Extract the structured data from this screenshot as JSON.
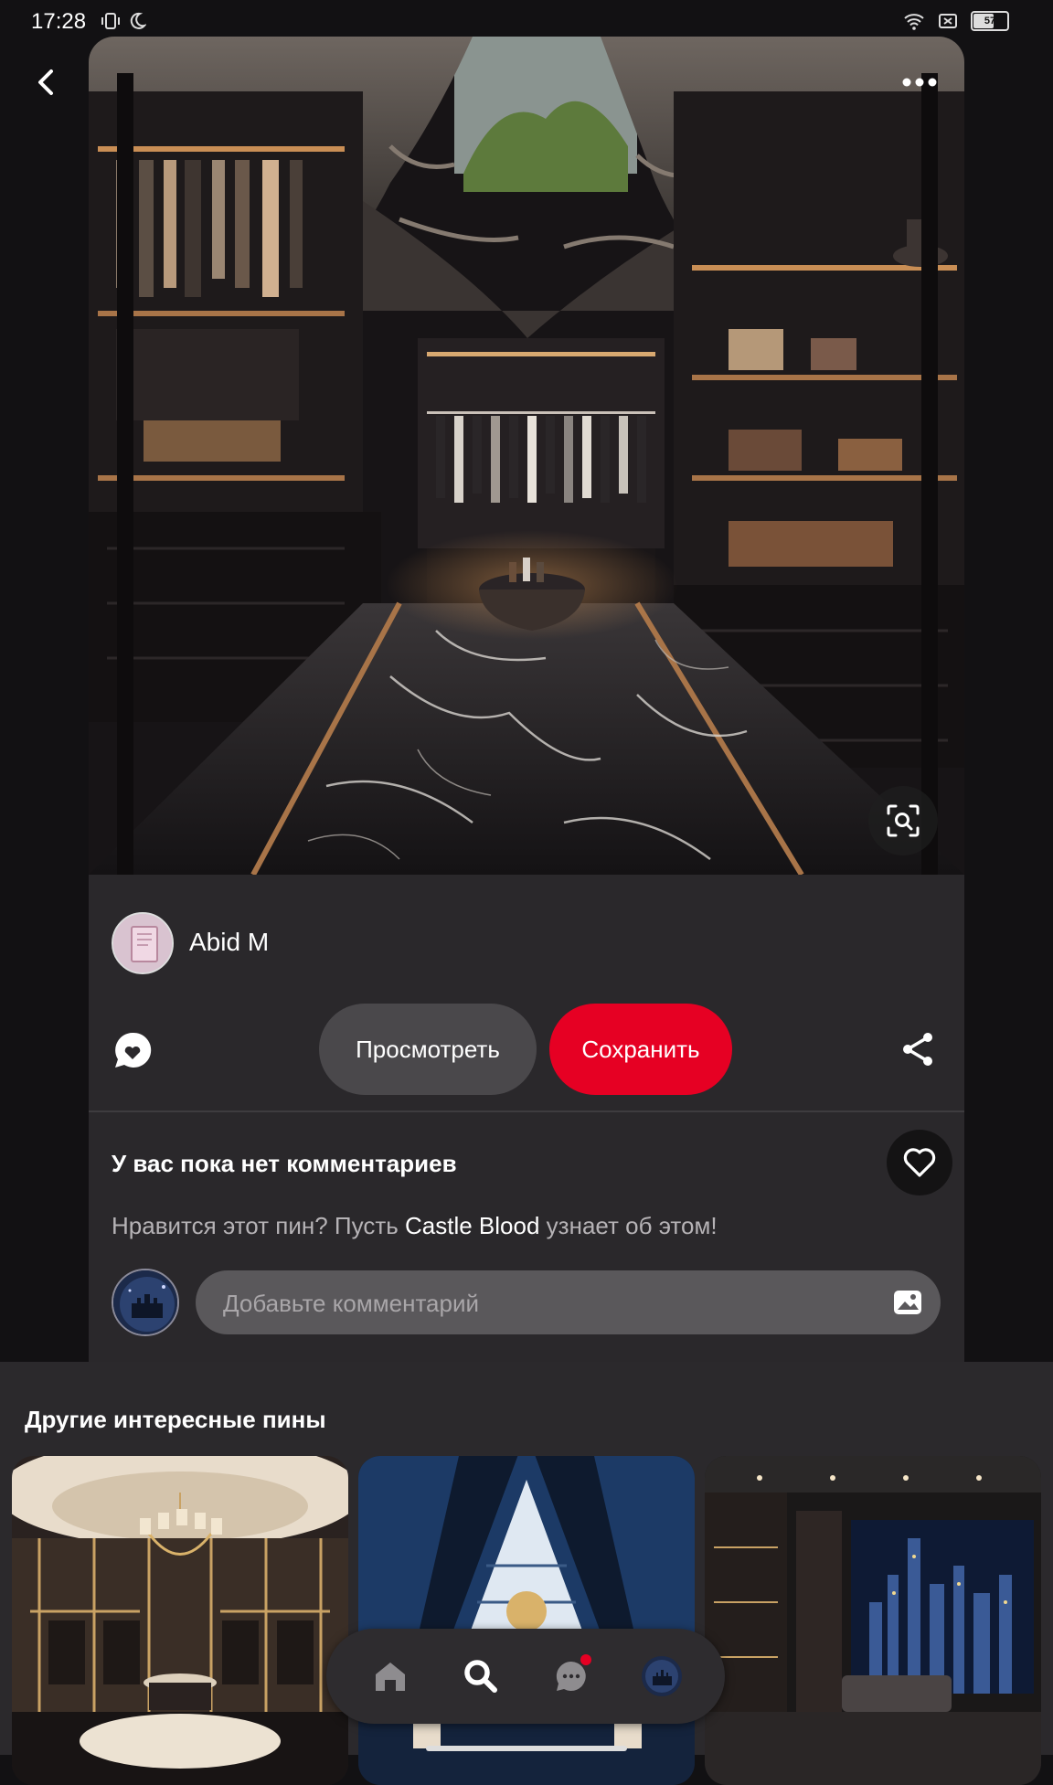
{
  "status_bar": {
    "time": "17:28",
    "battery": "57",
    "battery_fraction": 0.57,
    "icons": [
      "vibrate-icon",
      "moon-icon",
      "wifi-icon",
      "sim-off-icon",
      "battery-icon"
    ]
  },
  "pin": {
    "author_name": "Abid M",
    "view_label": "Просмотреть",
    "save_label": "Сохранить",
    "save_color": "#e60023"
  },
  "comments": {
    "title": "У вас пока нет комментариев",
    "prompt_before": "Нравится этот пин? Пусть ",
    "prompt_name": "Castle Blood",
    "prompt_after": " узнает об этом!",
    "input_placeholder": "Добавьте комментарий"
  },
  "more_pins": {
    "title": "Другие интересные пины"
  },
  "bottom_nav": {
    "items": [
      "home-icon",
      "search-icon",
      "messages-icon",
      "profile-avatar"
    ],
    "messages_has_notification": true
  },
  "colors": {
    "background": "#121113",
    "card": "#2a282b",
    "accent": "#e60023"
  }
}
